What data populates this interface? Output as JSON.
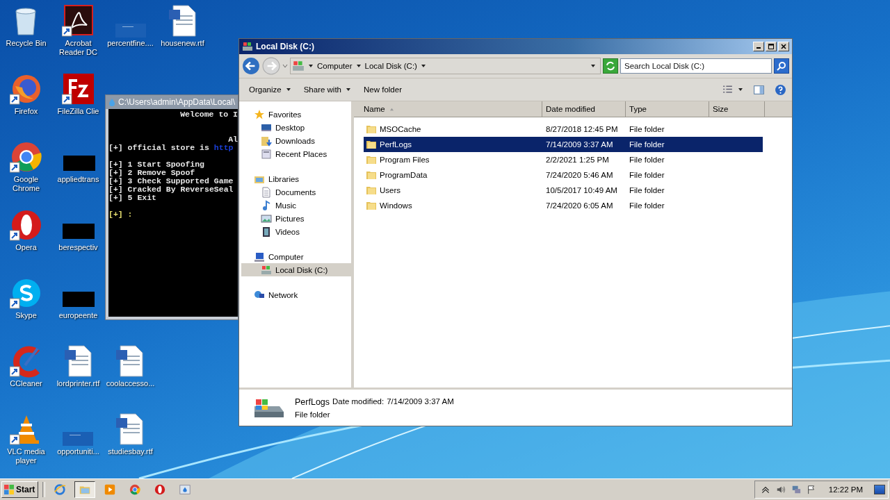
{
  "desktop_rows": [
    [
      {
        "label": "Recycle Bin",
        "kind": "recycle",
        "shortcut": false
      },
      {
        "label": "Acrobat Reader DC",
        "kind": "acrobat",
        "shortcut": true
      },
      {
        "label": "percentfine....",
        "kind": "blank",
        "shortcut": false
      },
      {
        "label": "housenew.rtf",
        "kind": "word",
        "shortcut": false
      }
    ],
    [
      {
        "label": "Firefox",
        "kind": "firefox",
        "shortcut": true
      },
      {
        "label": "FileZilla Clie",
        "kind": "filezilla",
        "shortcut": true
      }
    ],
    [
      {
        "label": "Google Chrome",
        "kind": "chrome",
        "shortcut": true
      },
      {
        "label": "appliedtrans",
        "kind": "black",
        "shortcut": false
      }
    ],
    [
      {
        "label": "Opera",
        "kind": "opera",
        "shortcut": true
      },
      {
        "label": "berespectiv",
        "kind": "black",
        "shortcut": false
      }
    ],
    [
      {
        "label": "Skype",
        "kind": "skype",
        "shortcut": true
      },
      {
        "label": "europeente",
        "kind": "black",
        "shortcut": false
      }
    ],
    [
      {
        "label": "CCleaner",
        "kind": "ccleaner",
        "shortcut": true
      },
      {
        "label": "lordprinter.rtf",
        "kind": "word",
        "shortcut": false
      },
      {
        "label": "coolaccesso...",
        "kind": "word",
        "shortcut": false
      }
    ],
    [
      {
        "label": "VLC media player",
        "kind": "vlc",
        "shortcut": true
      },
      {
        "label": "opportuniti...",
        "kind": "blank",
        "shortcut": false
      },
      {
        "label": "studiesbay.rtf",
        "kind": "word",
        "shortcut": false
      }
    ]
  ],
  "console": {
    "title": "C:\\Users\\admin\\AppData\\Local\\",
    "lines": [
      {
        "kind": "right",
        "text": "Welcome to I"
      },
      {
        "kind": "blank"
      },
      {
        "kind": "blank"
      },
      {
        "kind": "right",
        "text": "Al"
      },
      {
        "kind": "link",
        "text": "[+] official store is ",
        "link": "http"
      },
      {
        "kind": "blank"
      },
      {
        "kind": "plain",
        "text": "[+] 1 Start Spoofing"
      },
      {
        "kind": "plain",
        "text": "[+] 2 Remove Spoof"
      },
      {
        "kind": "plain",
        "text": "[+] 3 Check Supported Game"
      },
      {
        "kind": "plain",
        "text": "[+] Cracked By ReverseSeal"
      },
      {
        "kind": "plain",
        "text": "[+] 5 Exit"
      },
      {
        "kind": "blank"
      },
      {
        "kind": "prompt",
        "text": "[+] :"
      }
    ]
  },
  "explorer": {
    "title": "Local Disk (C:)",
    "breadcrumb": [
      "Computer",
      "Local Disk (C:)"
    ],
    "search": {
      "placeholder": "Search Local Disk (C:)"
    },
    "toolbar": [
      {
        "label": "Organize",
        "dropdown": true
      },
      {
        "label": "Share with",
        "dropdown": true
      },
      {
        "label": "New folder",
        "dropdown": false
      }
    ],
    "nav": [
      {
        "label": "Favorites",
        "kind": "star",
        "selected": false,
        "children": [
          {
            "label": "Desktop",
            "kind": "desktop",
            "selected": false
          },
          {
            "label": "Downloads",
            "kind": "downloads",
            "selected": false
          },
          {
            "label": "Recent Places",
            "kind": "recent",
            "selected": false
          }
        ]
      },
      {
        "label": "Libraries",
        "kind": "libraries",
        "selected": false,
        "children": [
          {
            "label": "Documents",
            "kind": "documents",
            "selected": false
          },
          {
            "label": "Music",
            "kind": "music",
            "selected": false
          },
          {
            "label": "Pictures",
            "kind": "pictures",
            "selected": false
          },
          {
            "label": "Videos",
            "kind": "videos",
            "selected": false
          }
        ]
      },
      {
        "label": "Computer",
        "kind": "computer",
        "selected": false,
        "children": [
          {
            "label": "Local Disk (C:)",
            "kind": "disk",
            "selected": true
          }
        ]
      },
      {
        "label": "Network",
        "kind": "network",
        "selected": false
      }
    ],
    "columns": [
      "Name",
      "Date modified",
      "Type",
      "Size"
    ],
    "rows": [
      {
        "name": "MSOCache",
        "date": "8/27/2018 12:45 PM",
        "type": "File folder",
        "selected": false
      },
      {
        "name": "PerfLogs",
        "date": "7/14/2009 3:37 AM",
        "type": "File folder",
        "selected": true
      },
      {
        "name": "Program Files",
        "date": "2/2/2021 1:25 PM",
        "type": "File folder",
        "selected": false
      },
      {
        "name": "ProgramData",
        "date": "7/24/2020 5:46 AM",
        "type": "File folder",
        "selected": false
      },
      {
        "name": "Users",
        "date": "10/5/2017 10:49 AM",
        "type": "File folder",
        "selected": false
      },
      {
        "name": "Windows",
        "date": "7/24/2020 6:05 AM",
        "type": "File folder",
        "selected": false
      }
    ],
    "details": {
      "name": "PerfLogs",
      "date_label": "Date modified:",
      "date": "7/14/2009 3:37 AM",
      "type": "File folder"
    }
  },
  "taskbar": {
    "start": "Start",
    "items": [
      {
        "kind": "ie",
        "selected": false
      },
      {
        "kind": "explorer",
        "selected": true
      },
      {
        "kind": "media",
        "selected": false
      },
      {
        "kind": "chrome",
        "selected": false
      },
      {
        "kind": "opera",
        "selected": false
      },
      {
        "kind": "app",
        "selected": false
      }
    ],
    "clock": "12:22 PM"
  }
}
